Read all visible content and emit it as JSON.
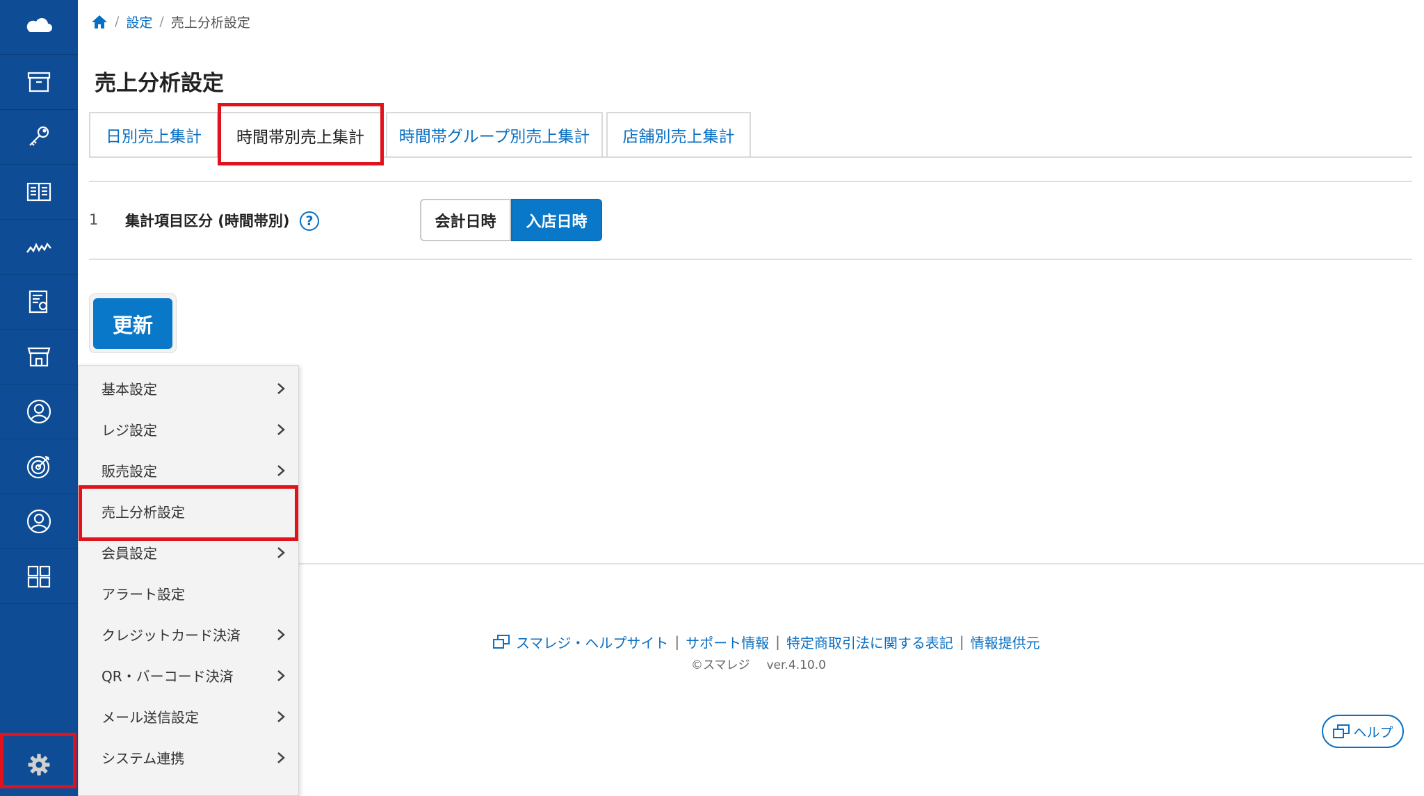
{
  "sidebar": {
    "items": [
      {
        "icon": "cloud-logo-icon"
      },
      {
        "icon": "archive-box-icon"
      },
      {
        "icon": "key-icon"
      },
      {
        "icon": "book-icon"
      },
      {
        "icon": "analytics-line-icon"
      },
      {
        "icon": "report-icon"
      },
      {
        "icon": "store-icon"
      },
      {
        "icon": "customer-icon"
      },
      {
        "icon": "target-icon"
      },
      {
        "icon": "user-icon"
      },
      {
        "icon": "apps-grid-icon"
      }
    ],
    "settings_icon": "gear-icon"
  },
  "breadcrumb": {
    "home_icon": "home-icon",
    "separator": "/",
    "parent": "設定",
    "current": "売上分析設定"
  },
  "page_title": "売上分析設定",
  "tabs": [
    {
      "label": "日別売上集計",
      "active": false
    },
    {
      "label": "時間帯別売上集計",
      "active": true
    },
    {
      "label": "時間帯グループ別売上集計",
      "active": false
    },
    {
      "label": "店舗別売上集計",
      "active": false
    }
  ],
  "setting": {
    "number": "1",
    "label": "集計項目区分 (時間帯別)",
    "help": "?",
    "options": [
      "会計日時",
      "入店日時"
    ],
    "selected": "入店日時"
  },
  "update_button": "更新",
  "menu": {
    "items": [
      {
        "label": "基本設定",
        "has_submenu": true
      },
      {
        "label": "レジ設定",
        "has_submenu": true
      },
      {
        "label": "販売設定",
        "has_submenu": true
      },
      {
        "label": "売上分析設定",
        "has_submenu": false
      },
      {
        "label": "会員設定",
        "has_submenu": true
      },
      {
        "label": "アラート設定",
        "has_submenu": false
      },
      {
        "label": "クレジットカード決済",
        "has_submenu": true
      },
      {
        "label": "QR・バーコード決済",
        "has_submenu": true
      },
      {
        "label": "メール送信設定",
        "has_submenu": true
      },
      {
        "label": "システム連携",
        "has_submenu": true
      }
    ]
  },
  "footer": {
    "links": [
      "スマレジ・ヘルプサイト",
      "サポート情報",
      "特定商取引法に関する表記",
      "情報提供元"
    ],
    "separator": "|",
    "copyright": "©スマレジ",
    "version": "ver.4.10.0"
  },
  "help_button": "ヘルプ",
  "colors": {
    "sidebar_bg": "#0e4d96",
    "accent": "#0a78c8",
    "link": "#0a6fc2",
    "highlight_box": "#e0121b"
  }
}
